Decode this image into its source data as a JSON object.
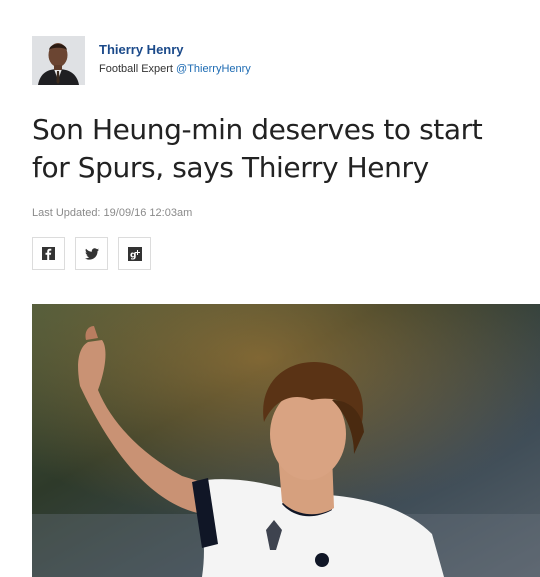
{
  "author": {
    "name": "Thierry Henry",
    "role": "Football Expert",
    "handle": "@ThierryHenry"
  },
  "article": {
    "headline": "Son Heung-min deserves to start for Spurs, says Thierry Henry",
    "last_updated": "Last Updated: 19/09/16 12:03am"
  },
  "share": {
    "buttons": [
      {
        "icon": "facebook-icon"
      },
      {
        "icon": "twitter-icon"
      },
      {
        "icon": "google-plus-icon"
      }
    ]
  },
  "colors": {
    "author_name": "#1b4a8a",
    "handle": "#1d6bb3",
    "headline": "#222222",
    "meta": "#8a8a8a"
  }
}
